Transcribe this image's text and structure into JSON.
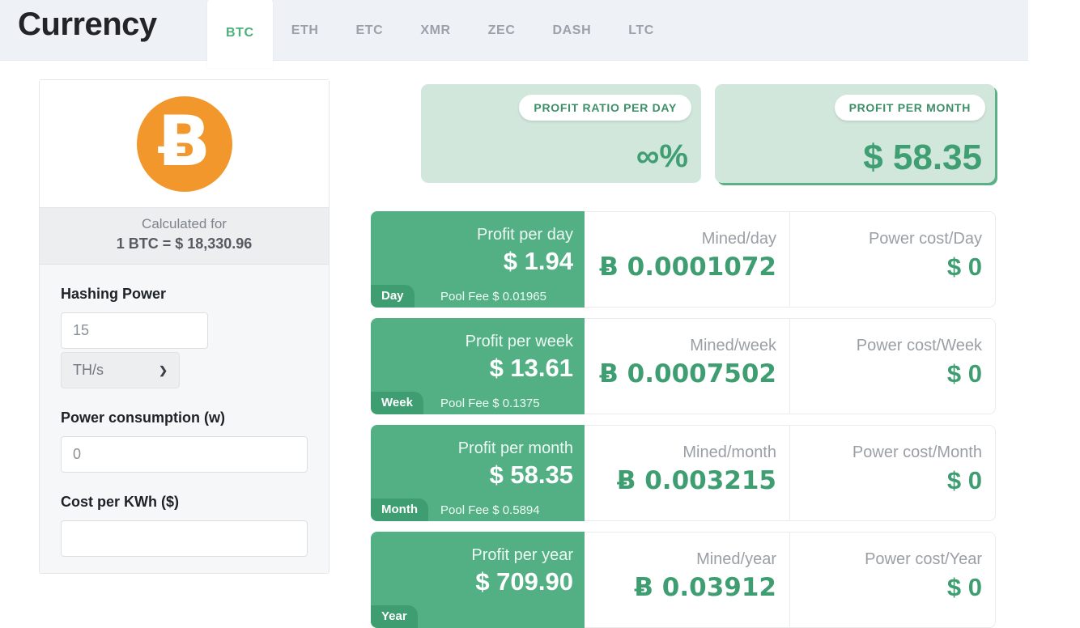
{
  "header": {
    "title": "Currency",
    "tabs": [
      {
        "label": "BTC",
        "active": true
      },
      {
        "label": "ETH",
        "active": false
      },
      {
        "label": "ETC",
        "active": false
      },
      {
        "label": "XMR",
        "active": false
      },
      {
        "label": "ZEC",
        "active": false
      },
      {
        "label": "DASH",
        "active": false
      },
      {
        "label": "LTC",
        "active": false
      }
    ]
  },
  "sidebar": {
    "coin_icon": "bitcoin-icon",
    "coin_symbol": "Ƀ",
    "calculated_label": "Calculated for",
    "calculated_rate": "1 BTC = $ 18,330.96",
    "fields": {
      "hashing_power_label": "Hashing Power",
      "hashing_power_value": "15",
      "hashing_unit_value": "TH/s",
      "power_consumption_label": "Power consumption (w)",
      "power_consumption_value": "0",
      "cost_per_kwh_label": "Cost per KWh ($)",
      "cost_per_kwh_value": ""
    }
  },
  "summary_cards": [
    {
      "badge": "PROFIT RATIO PER DAY",
      "value": "∞%"
    },
    {
      "badge": "PROFIT PER MONTH",
      "value": "$ 58.35"
    }
  ],
  "rows": [
    {
      "period": "Day",
      "profit_label": "Profit per day",
      "profit_value": "$ 1.94",
      "pool_fee": "Pool Fee $ 0.01965",
      "mined_label": "Mined/day",
      "mined_value": "Ƀ 0.0001072",
      "power_label": "Power cost/Day",
      "power_value": "$ 0"
    },
    {
      "period": "Week",
      "profit_label": "Profit per week",
      "profit_value": "$ 13.61",
      "pool_fee": "Pool Fee $ 0.1375",
      "mined_label": "Mined/week",
      "mined_value": "Ƀ 0.0007502",
      "power_label": "Power cost/Week",
      "power_value": "$ 0"
    },
    {
      "period": "Month",
      "profit_label": "Profit per month",
      "profit_value": "$ 58.35",
      "pool_fee": "Pool Fee $ 0.5894",
      "mined_label": "Mined/month",
      "mined_value": "Ƀ 0.003215",
      "power_label": "Power cost/Month",
      "power_value": "$ 0"
    },
    {
      "period": "Year",
      "profit_label": "Profit per year",
      "profit_value": "$ 709.90",
      "pool_fee": "",
      "mined_label": "Mined/year",
      "mined_value": "Ƀ 0.03912",
      "power_label": "Power cost/Year",
      "power_value": "$ 0"
    }
  ],
  "colors": {
    "accent_green": "#3f9e71",
    "panel_green": "#52b084",
    "card_green": "#d2e7db",
    "bitcoin_orange": "#f1972c",
    "header_gray": "#eef1f5"
  },
  "icons": {
    "chevron_down": "⌄"
  }
}
